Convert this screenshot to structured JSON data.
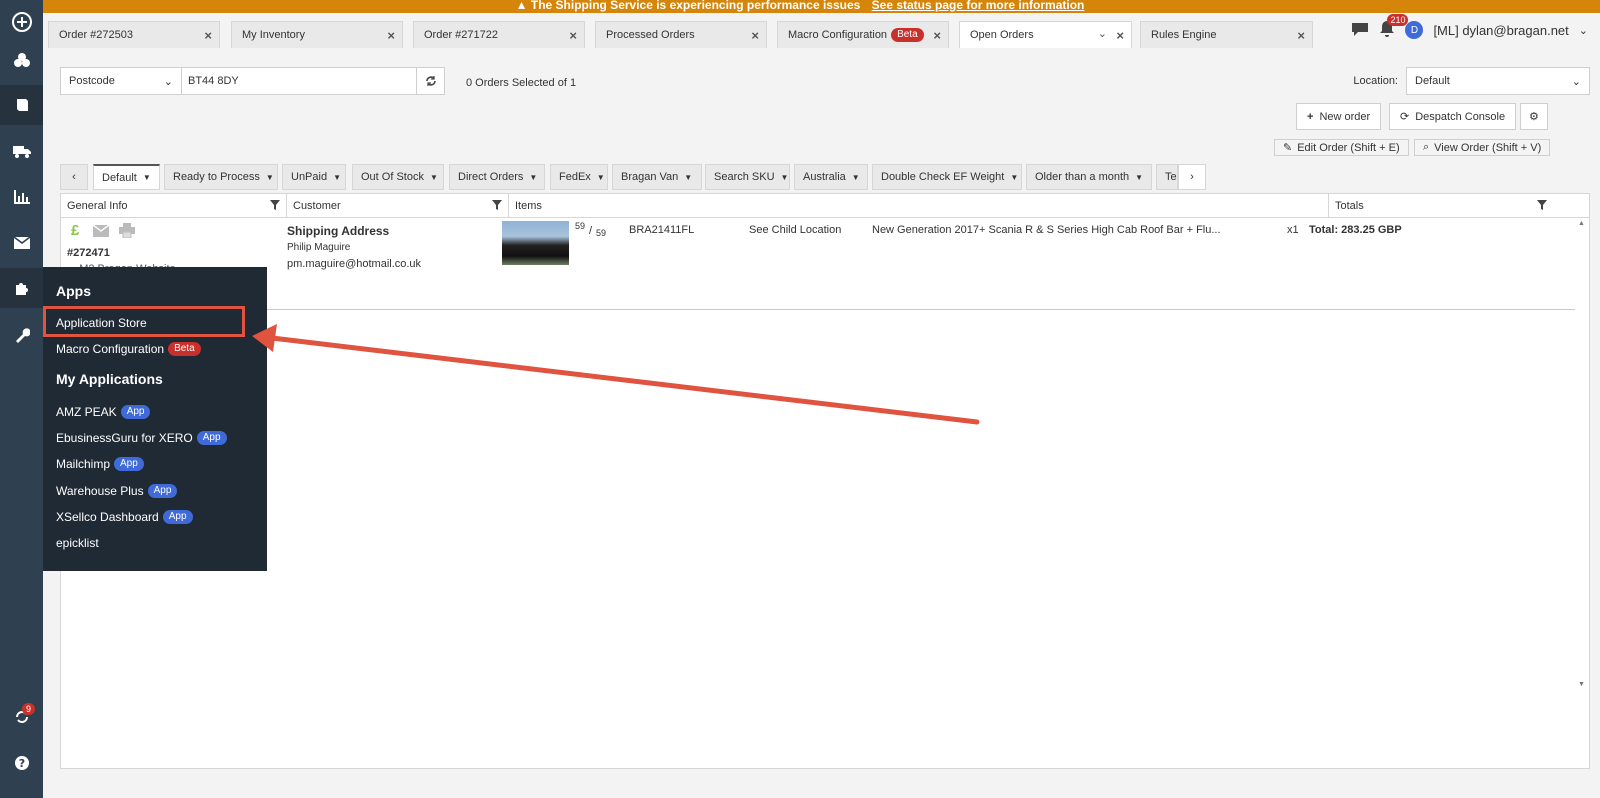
{
  "banner": {
    "message": "The Shipping Service is experiencing performance issues",
    "link": "See status page for more information",
    "icon": "warning-icon"
  },
  "tabs": [
    {
      "label": "Order #272503",
      "badge": null
    },
    {
      "label": "My Inventory",
      "badge": null
    },
    {
      "label": "Order #271722",
      "badge": null
    },
    {
      "label": "Processed Orders",
      "badge": null
    },
    {
      "label": "Macro Configuration",
      "badge": "Beta"
    },
    {
      "label": "Open Orders",
      "badge": null
    },
    {
      "label": "Rules Engine",
      "badge": null
    }
  ],
  "header": {
    "notification_count": "210",
    "avatar_initial": "D",
    "user": "[ML] dylan@bragan.net"
  },
  "search": {
    "field": "Postcode",
    "value": "BT44 8DY",
    "selected_text": "0 Orders Selected of 1"
  },
  "location": {
    "label": "Location:",
    "value": "Default"
  },
  "actions": {
    "new_order": "New order",
    "despatch_console": "Despatch Console",
    "edit_order": "Edit Order (Shift + E)",
    "view_order": "View Order (Shift + V)"
  },
  "views": [
    "Default",
    "Ready to Process",
    "UnPaid",
    "Out Of Stock",
    "Direct Orders",
    "FedEx",
    "Bragan Van",
    "Search SKU",
    "Australia",
    "Double Check EF Weight",
    "Older than a month",
    "Te"
  ],
  "grid": {
    "columns": [
      "General Info",
      "Customer",
      "Items",
      "Totals"
    ],
    "order": {
      "currency_symbol": "£",
      "number": "#272471",
      "source_partial": "... M2 Bragan Website",
      "shipping_heading": "Shipping Address",
      "customer_name": "Philip Maguire",
      "email": "pm.maguire@hotmail.co.uk",
      "qty_top": "59",
      "qty_sep": "/",
      "qty_bottom": "59",
      "sku": "BRA21411FL",
      "location": "See Child Location",
      "title": "New Generation 2017+ Scania R & S Series High Cab Roof Bar + Flu...",
      "quantity": "x1",
      "total": "Total: 283.25 GBP"
    }
  },
  "apps_menu": {
    "apps_heading": "Apps",
    "application_store": "Application Store",
    "macro_configuration": "Macro Configuration",
    "macro_badge": "Beta",
    "my_apps_heading": "My Applications",
    "apps": [
      {
        "label": "AMZ PEAK",
        "badge": "App"
      },
      {
        "label": "EbusinessGuru for XERO",
        "badge": "App"
      },
      {
        "label": "Mailchimp",
        "badge": "App"
      },
      {
        "label": "Warehouse Plus",
        "badge": "App"
      },
      {
        "label": "XSellco Dashboard",
        "badge": "App"
      },
      {
        "label": "epicklist",
        "badge": null
      }
    ]
  },
  "sidebar": {
    "sync_count": "9"
  },
  "colors": {
    "banner": "#d4850a",
    "sidebar": "#2f4050",
    "menu": "#1f2a35",
    "highlight": "#e0533f",
    "beta_badge": "#c9302c",
    "app_badge": "#3f6ad8"
  }
}
